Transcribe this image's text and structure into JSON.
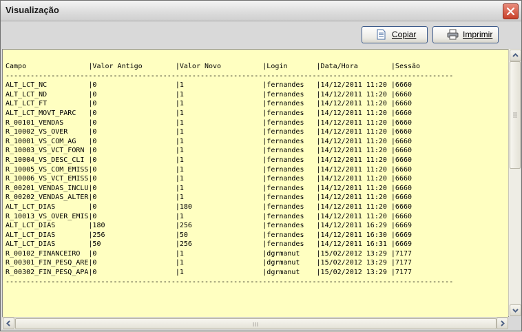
{
  "window": {
    "title": "Visualização"
  },
  "toolbar": {
    "copy_label": "Copiar",
    "print_label": "Imprimir"
  },
  "report": {
    "header": "Campo               |Valor Antigo        |Valor Novo          |Login       |Data/Hora        |Sessão",
    "separator": "------------------------------------------------------------------------------------------------------------",
    "rows": [
      "ALT_LCT_NC          |0                   |1                   |fernandes   |14/12/2011 11:20 |6660",
      "ALT_LCT_ND          |0                   |1                   |fernandes   |14/12/2011 11:20 |6660",
      "ALT_LCT_FT          |0                   |1                   |fernandes   |14/12/2011 11:20 |6660",
      "ALT_LCT_MOVT_PARC   |0                   |1                   |fernandes   |14/12/2011 11:20 |6660",
      "R_00101_VENDAS      |0                   |1                   |fernandes   |14/12/2011 11:20 |6660",
      "R_10002_VS_OVER     |0                   |1                   |fernandes   |14/12/2011 11:20 |6660",
      "R_10001_VS_COM_AG   |0                   |1                   |fernandes   |14/12/2011 11:20 |6660",
      "R_10003_VS_VCT_FORN |0                   |1                   |fernandes   |14/12/2011 11:20 |6660",
      "R_10004_VS_DESC_CLI |0                   |1                   |fernandes   |14/12/2011 11:20 |6660",
      "R_10005_VS_COM_EMISS|0                   |1                   |fernandes   |14/12/2011 11:20 |6660",
      "R_10006_VS_VCT_EMISS|0                   |1                   |fernandes   |14/12/2011 11:20 |6660",
      "R_00201_VENDAS_INCLU|0                   |1                   |fernandes   |14/12/2011 11:20 |6660",
      "R_00202_VENDAS_ALTER|0                   |1                   |fernandes   |14/12/2011 11:20 |6660",
      "ALT_LCT_DIAS        |0                   |180                 |fernandes   |14/12/2011 11:20 |6660",
      "R_10013_VS_OVER_EMIS|0                   |1                   |fernandes   |14/12/2011 11:20 |6660",
      "ALT_LCT_DIAS        |180                 |256                 |fernandes   |14/12/2011 16:29 |6669",
      "ALT_LCT_DIAS        |256                 |50                  |fernandes   |14/12/2011 16:30 |6669",
      "ALT_LCT_DIAS        |50                  |256                 |fernandes   |14/12/2011 16:31 |6669",
      "R_00102_FINANCEIRO  |0                   |1                   |dgrmanut    |15/02/2012 13:29 |7177",
      "R_00301_FIN_PESQ_ARE|0                   |1                   |dgrmanut    |15/02/2012 13:29 |7177",
      "R_00302_FIN_PESQ_APA|0                   |1                   |dgrmanut    |15/02/2012 13:29 |7177"
    ]
  },
  "colors": {
    "content_bg": "#ffffc1",
    "close_red": "#c9412a",
    "button_border": "#3c5a8a"
  },
  "icons": {
    "copy": "document-icon",
    "print": "printer-icon",
    "close": "close-icon"
  }
}
